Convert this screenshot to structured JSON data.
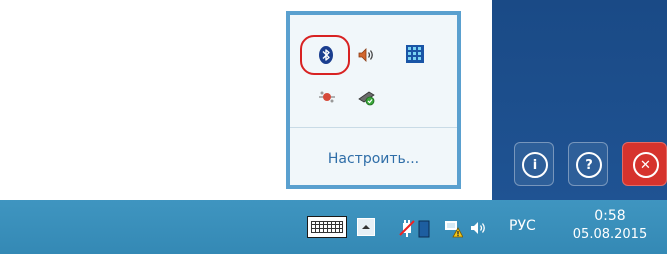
{
  "popup": {
    "icons": [
      {
        "name": "bluetooth-icon",
        "highlighted": true
      },
      {
        "name": "volume-icon"
      },
      {
        "name": "network-monitor-icon"
      },
      {
        "name": "usb-device-icon"
      },
      {
        "name": "safely-remove-hardware-icon"
      }
    ],
    "customize_label": "Настроить..."
  },
  "app_buttons": [
    {
      "name": "info-button",
      "glyph": "i"
    },
    {
      "name": "help-button",
      "glyph": "?"
    },
    {
      "name": "close-button",
      "glyph": "✕"
    }
  ],
  "taskbar": {
    "icons": [
      "touch-keyboard-icon",
      "show-hidden-icons-icon",
      "power-plug-icon",
      "action-center-warning-icon",
      "volume-icon"
    ],
    "language": "РУС",
    "clock": {
      "time": "0:58",
      "date": "05.08.2015"
    }
  },
  "colors": {
    "taskbar": "#3a8fba",
    "popup_border": "#5aa0cf",
    "popup_background": "#f1f7fa",
    "app_area": "#1d4f8b",
    "close_button": "#d6332d",
    "highlight_ring": "#d82222",
    "link": "#2f6ea8"
  }
}
